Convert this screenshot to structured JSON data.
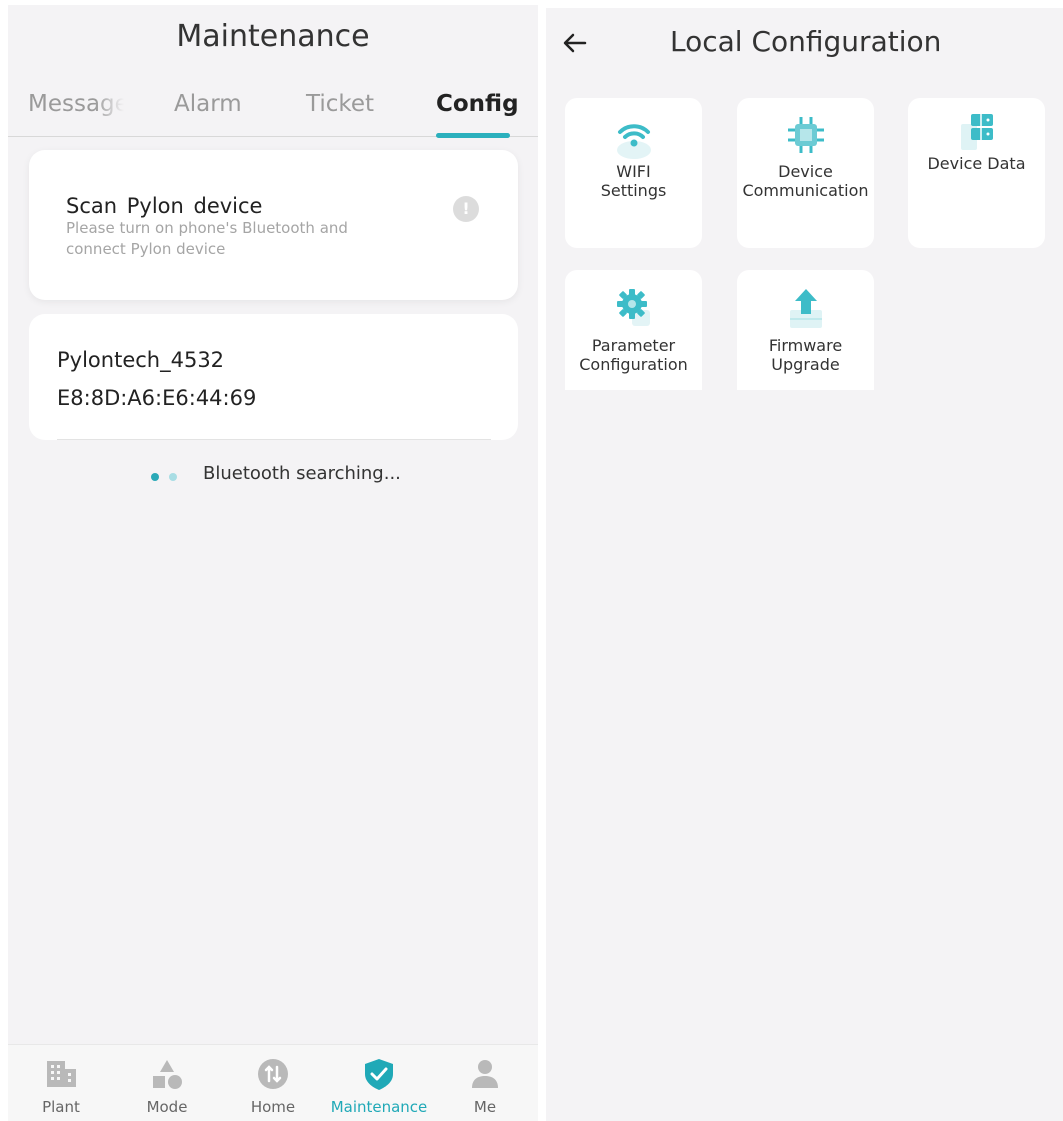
{
  "left_screen": {
    "title": "Maintenance",
    "tabs": [
      {
        "label": "Message"
      },
      {
        "label": "Alarm"
      },
      {
        "label": "Ticket"
      },
      {
        "label": "Config",
        "active": true
      }
    ],
    "scan_card": {
      "title": "Scan Pylon device",
      "subtitle": "Please turn on phone's Bluetooth and connect Pylon device",
      "info_icon": "info-icon"
    },
    "device": {
      "name": "Pylontech_4532",
      "mac": "E8:8D:A6:E6:44:69"
    },
    "status": "Bluetooth searching...",
    "bottom_nav": [
      {
        "label": "Plant",
        "icon": "building-icon"
      },
      {
        "label": "Mode",
        "icon": "shapes-icon"
      },
      {
        "label": "Home",
        "icon": "home-arrows-icon"
      },
      {
        "label": "Maintenance",
        "icon": "shield-check-icon",
        "active": true
      },
      {
        "label": "Me",
        "icon": "person-icon"
      }
    ]
  },
  "right_screen": {
    "title": "Local Configuration",
    "back_icon": "arrow-left-icon",
    "tiles": [
      {
        "label_line1": "WIFI",
        "label_line2": "Settings",
        "icon": "wifi-cloud-icon"
      },
      {
        "label_line1": "Device",
        "label_line2": "Communication",
        "icon": "chip-icon"
      },
      {
        "label_line1": "Device Data",
        "label_line2": "",
        "icon": "database-icon"
      },
      {
        "label_line1": "Parameter",
        "label_line2": "Configuration",
        "icon": "gear-icon"
      },
      {
        "label_line1": "Firmware",
        "label_line2": "Upgrade",
        "icon": "upload-icon"
      }
    ]
  },
  "colors": {
    "accent": "#2bb0bd",
    "background": "#f4f3f5",
    "card": "#ffffff",
    "inactive_tab": "#9a9a9a"
  }
}
